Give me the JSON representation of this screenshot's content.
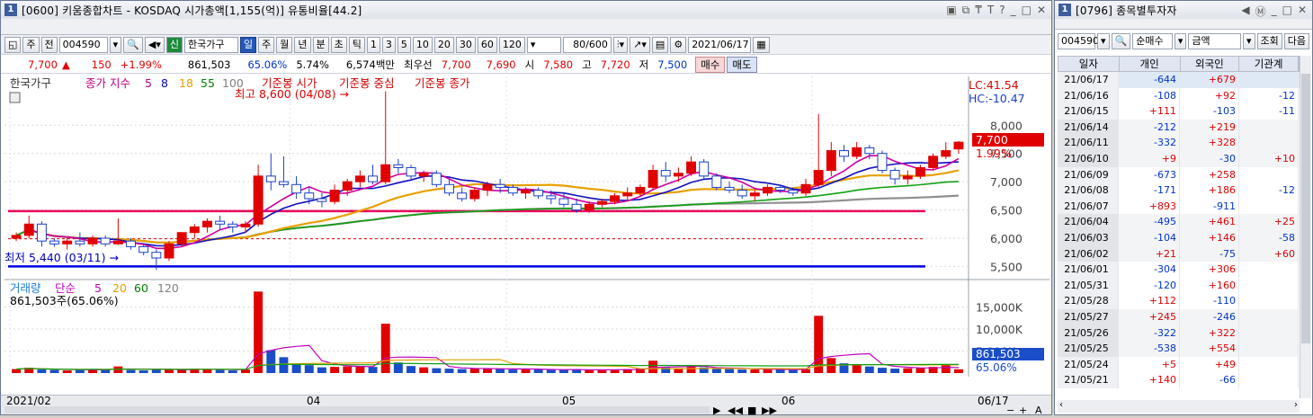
{
  "chart_window": {
    "number": "1",
    "title": "[0600] 키움종합차트 - KOSDAQ 시가총액[1,155(억)] 유통비율[44.2]",
    "toolbar": {
      "code_prefix": "주",
      "mode": "전",
      "code": "004590",
      "stock_badge": "신",
      "stock_name": "한국가구",
      "periods": [
        "일",
        "주",
        "월",
        "년",
        "분",
        "초",
        "틱"
      ],
      "selected_period": "일",
      "minutes": [
        "1",
        "3",
        "5",
        "10",
        "20",
        "30",
        "60",
        "120"
      ],
      "count": "80/600",
      "date": "2021/06/17"
    },
    "quote": {
      "price": "7,700",
      "change": "150",
      "change_pct": "+1.99%",
      "volume": "861,503",
      "volume_pct": "65.06%",
      "turnover": "5.74%",
      "amount": "6,574백만",
      "best_label": "최우선",
      "best_sell": "7,700",
      "best_buy": "7,690",
      "open_label": "시",
      "open": "7,580",
      "high_label": "고",
      "high": "7,720",
      "low_label": "저",
      "low": "7,500",
      "buy_btn": "매수",
      "sell_btn": "매도"
    },
    "price_legend": {
      "stock": "한국가구",
      "ma_label": "종가 지수",
      "ma": [
        "5",
        "8",
        "18",
        "55",
        "100"
      ],
      "ref": "기준봉 시가",
      "ref2": "기준봉 중심",
      "ref3": "기준봉 종가",
      "lc": "LC:41.54",
      "hc": "HC:-10.47",
      "high_note": "최고 8,600 (04/08) →",
      "low_note": "최저 5,440 (03/11) →",
      "cur_price": "7,700",
      "cur_pct": "1.99%"
    },
    "volume_legend": {
      "label": "거래량",
      "ma_label": "단순",
      "ma": [
        "5",
        "20",
        "60",
        "120"
      ],
      "current": "861,503주(65.06%)",
      "cur_box": "861,503",
      "cur_pct": "65.06%"
    },
    "price_axis": [
      "8,000",
      "7,500",
      "7,000",
      "6,500",
      "6,000",
      "5,500"
    ],
    "volume_axis": [
      "15,000K",
      "10,000K",
      "5,000K"
    ],
    "x_labels": [
      "2021/02",
      "04",
      "05",
      "06",
      "06/17"
    ]
  },
  "chart_data": {
    "type": "candlestick",
    "y_range": [
      5300,
      8800
    ],
    "candles": [
      [
        6000,
        6100,
        5950,
        6050
      ],
      [
        6050,
        6400,
        6000,
        6250
      ],
      [
        6250,
        6300,
        5850,
        5950
      ],
      [
        5950,
        6000,
        5850,
        5900
      ],
      [
        5900,
        6000,
        5800,
        5950
      ],
      [
        5950,
        6100,
        5850,
        5900
      ],
      [
        5900,
        6050,
        5850,
        6000
      ],
      [
        6000,
        6050,
        5850,
        5900
      ],
      [
        5900,
        6350,
        5880,
        5950
      ],
      [
        5950,
        6000,
        5800,
        5850
      ],
      [
        5850,
        5900,
        5700,
        5750
      ],
      [
        5750,
        5800,
        5440,
        5650
      ],
      [
        5650,
        5950,
        5600,
        5900
      ],
      [
        5900,
        6100,
        5850,
        6100
      ],
      [
        6100,
        6250,
        6000,
        6200
      ],
      [
        6200,
        6350,
        6100,
        6300
      ],
      [
        6300,
        6400,
        6150,
        6250
      ],
      [
        6250,
        6300,
        6100,
        6200
      ],
      [
        6200,
        6300,
        6100,
        6250
      ],
      [
        6250,
        7300,
        6200,
        7100
      ],
      [
        7100,
        7500,
        6850,
        7000
      ],
      [
        7000,
        7450,
        6900,
        6950
      ],
      [
        6950,
        7100,
        6700,
        6800
      ],
      [
        6800,
        6900,
        6600,
        6700
      ],
      [
        6700,
        6800,
        6550,
        6650
      ],
      [
        6650,
        6950,
        6600,
        6850
      ],
      [
        6850,
        7050,
        6750,
        7000
      ],
      [
        7000,
        7200,
        6900,
        7100
      ],
      [
        7100,
        7300,
        6950,
        7000
      ],
      [
        7000,
        8600,
        6950,
        7300
      ],
      [
        7300,
        7400,
        7150,
        7250
      ],
      [
        7250,
        7300,
        7050,
        7100
      ],
      [
        7100,
        7200,
        7000,
        7150
      ],
      [
        7150,
        7200,
        6900,
        6950
      ],
      [
        6950,
        7050,
        6750,
        6800
      ],
      [
        6800,
        6900,
        6650,
        6700
      ],
      [
        6700,
        6900,
        6650,
        6850
      ],
      [
        6850,
        7000,
        6750,
        6950
      ],
      [
        6950,
        7050,
        6800,
        6900
      ],
      [
        6900,
        6950,
        6750,
        6800
      ],
      [
        6800,
        6900,
        6700,
        6850
      ],
      [
        6850,
        6900,
        6700,
        6750
      ],
      [
        6750,
        6850,
        6600,
        6700
      ],
      [
        6700,
        6800,
        6550,
        6600
      ],
      [
        6600,
        6700,
        6450,
        6500
      ],
      [
        6500,
        6650,
        6450,
        6600
      ],
      [
        6600,
        6700,
        6550,
        6650
      ],
      [
        6650,
        6800,
        6600,
        6750
      ],
      [
        6750,
        6900,
        6650,
        6800
      ],
      [
        6800,
        6950,
        6750,
        6900
      ],
      [
        6900,
        7300,
        6850,
        7200
      ],
      [
        7200,
        7350,
        7000,
        7100
      ],
      [
        7100,
        7250,
        7000,
        7150
      ],
      [
        7150,
        7450,
        7100,
        7350
      ],
      [
        7350,
        7400,
        7050,
        7100
      ],
      [
        7100,
        7150,
        6850,
        6900
      ],
      [
        6900,
        7000,
        6800,
        6850
      ],
      [
        6850,
        6950,
        6700,
        6750
      ],
      [
        6750,
        6850,
        6650,
        6800
      ],
      [
        6800,
        6950,
        6750,
        6900
      ],
      [
        6900,
        6950,
        6800,
        6850
      ],
      [
        6850,
        6900,
        6750,
        6800
      ],
      [
        6800,
        7050,
        6750,
        6950
      ],
      [
        6950,
        8200,
        6900,
        7200
      ],
      [
        7200,
        7700,
        7100,
        7550
      ],
      [
        7550,
        7650,
        7350,
        7450
      ],
      [
        7450,
        7700,
        7400,
        7600
      ],
      [
        7600,
        7650,
        7400,
        7500
      ],
      [
        7500,
        7550,
        7150,
        7200
      ],
      [
        7200,
        7250,
        6950,
        7050
      ],
      [
        7050,
        7200,
        6950,
        7100
      ],
      [
        7100,
        7300,
        7050,
        7250
      ],
      [
        7250,
        7500,
        7200,
        7450
      ],
      [
        7450,
        7700,
        7400,
        7550
      ],
      [
        7580,
        7720,
        7500,
        7700
      ]
    ],
    "volume": [
      900,
      1200,
      800,
      700,
      600,
      700,
      900,
      800,
      1500,
      700,
      600,
      900,
      700,
      800,
      1000,
      900,
      700,
      600,
      800,
      18500,
      5200,
      3600,
      2200,
      1800,
      1300,
      1400,
      1500,
      1600,
      1400,
      11200,
      2400,
      1600,
      1300,
      1100,
      1000,
      900,
      1000,
      1100,
      900,
      800,
      900,
      800,
      700,
      700,
      900,
      700,
      700,
      800,
      900,
      1000,
      2800,
      1300,
      1000,
      1500,
      1300,
      1000,
      900,
      800,
      800,
      900,
      800,
      700,
      900,
      13000,
      3400,
      2200,
      1800,
      1500,
      1200,
      1000,
      1100,
      1100,
      1400,
      1800,
      861
    ],
    "ma_labels": [
      "5",
      "8",
      "18",
      "55",
      "100"
    ],
    "x_labels": [
      "2021/02",
      "04",
      "05",
      "06",
      "06/17"
    ]
  },
  "investor_window": {
    "number": "1",
    "title": "[0796] 종목별투자자",
    "code": "004590",
    "mode": "순매수",
    "unit": "금액",
    "buttons": [
      "조회",
      "다음"
    ],
    "columns": [
      "일자",
      "개인",
      "외국인",
      "기관계"
    ],
    "rows": [
      [
        "21/06/17",
        "-644",
        "+679",
        ""
      ],
      [
        "21/06/16",
        "-108",
        "+92",
        "-12"
      ],
      [
        "21/06/15",
        "+111",
        "-103",
        "-11"
      ],
      [
        "21/06/14",
        "-212",
        "+219",
        ""
      ],
      [
        "21/06/11",
        "-332",
        "+328",
        ""
      ],
      [
        "21/06/10",
        "+9",
        "-30",
        "+10"
      ],
      [
        "21/06/09",
        "-673",
        "+258",
        ""
      ],
      [
        "21/06/08",
        "-171",
        "+186",
        "-12"
      ],
      [
        "21/06/07",
        "+893",
        "-911",
        ""
      ],
      [
        "21/06/04",
        "-495",
        "+461",
        "+25"
      ],
      [
        "21/06/03",
        "-104",
        "+146",
        "-58"
      ],
      [
        "21/06/02",
        "+21",
        "-75",
        "+60"
      ],
      [
        "21/06/01",
        "-304",
        "+306",
        ""
      ],
      [
        "21/05/31",
        "-120",
        "+160",
        ""
      ],
      [
        "21/05/28",
        "+112",
        "-110",
        ""
      ],
      [
        "21/05/27",
        "+245",
        "-246",
        ""
      ],
      [
        "21/05/26",
        "-322",
        "+322",
        ""
      ],
      [
        "21/05/25",
        "-538",
        "+554",
        ""
      ],
      [
        "21/05/24",
        "+5",
        "+49",
        ""
      ],
      [
        "21/05/21",
        "+140",
        "-66",
        ""
      ]
    ]
  }
}
